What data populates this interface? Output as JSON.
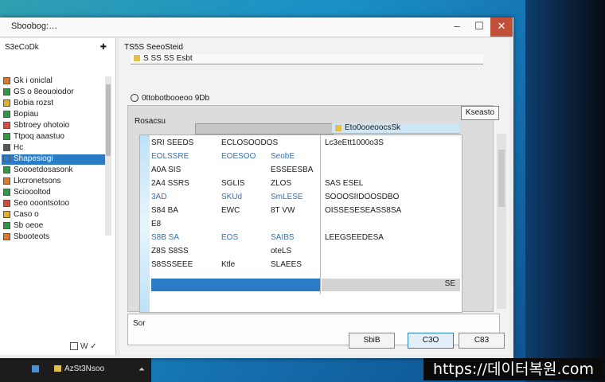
{
  "window": {
    "title": "Sboobog:…",
    "controls": {
      "minimize": "–",
      "maximize": "☐",
      "close": "✕"
    }
  },
  "left_pane": {
    "header": "S3eCoDk",
    "pin": "✚",
    "items": [
      {
        "label": "Gk i oniclal",
        "selected": false
      },
      {
        "label": "GS o 8eouoiodor",
        "selected": false
      },
      {
        "label": "Bobia rozst",
        "selected": false
      },
      {
        "label": "Bopiau",
        "selected": false
      },
      {
        "label": "Sbtroey ohotoio",
        "selected": false
      },
      {
        "label": "Ttpoq aaastuo",
        "selected": false
      },
      {
        "label": "Hc",
        "selected": false
      },
      {
        "label": "Shapesiogi",
        "selected": true
      },
      {
        "label": "Soooetdosasonk",
        "selected": false
      },
      {
        "label": "Lkcronetsons",
        "selected": false
      },
      {
        "label": "Scioooltod",
        "selected": false
      },
      {
        "label": "Seo ooontsotoo",
        "selected": false
      },
      {
        "label": "Caso o",
        "selected": false
      },
      {
        "label": "Sb oeoe",
        "selected": false
      },
      {
        "label": "Sbooteots",
        "selected": false
      }
    ],
    "footer": "W ✓"
  },
  "main": {
    "header": "TS5S  SeeoSteid",
    "breadcrumb": "S SS SS Esbt",
    "path_label": "0ttobotbooeoo 9Db",
    "inner_panel": {
      "title": "Rosacsu",
      "action_button": "Kseasto",
      "column_header": "Eto0ooeoocsSk",
      "rows": [
        {
          "c1": "SRI  SEEDS",
          "c2": "ECLOSOODOS",
          "c3": ""
        },
        {
          "c1": "EOLSSRE",
          "c2": "EOESOO",
          "c3": "SeobE"
        },
        {
          "c1": "A0A SIS",
          "c2": "",
          "c3": "ESSEESBA"
        },
        {
          "c1": "2A4 SSRS",
          "c2": "SGLIS",
          "c3": "ZLOS"
        },
        {
          "c1": "3AD",
          "c2": "SKUd",
          "c3": "SmLESE"
        },
        {
          "c1": "S84  BA",
          "c2": "EWC",
          "c3": "8T VW"
        },
        {
          "c1": "E8",
          "c2": "",
          "c3": ""
        },
        {
          "c1": "S8B  SA",
          "c2": "EOS",
          "c3": "SAIBS"
        },
        {
          "c1": "Z8S  S8SS",
          "c2": "",
          "c3": "oteLS"
        },
        {
          "c1": "S8SSSEEE",
          "c2": "Ktle",
          "c3": "SLAEES"
        }
      ],
      "details": [
        "Lc3eEtt1000o3S",
        "",
        "",
        "SAS ESEL",
        "SOOOSIIDOOSDBO",
        "OISSESESEASS8SA",
        "",
        "LEEGSEEDESA",
        "",
        ""
      ],
      "footer_tag": "SE"
    },
    "notes": "Sor"
  },
  "buttons": {
    "back": "SbiB",
    "ok": "C3O",
    "cancel": "C83"
  },
  "taskbar": {
    "label": "AzSt3Nsoo"
  },
  "watermark": "https://데이터복원.com"
}
